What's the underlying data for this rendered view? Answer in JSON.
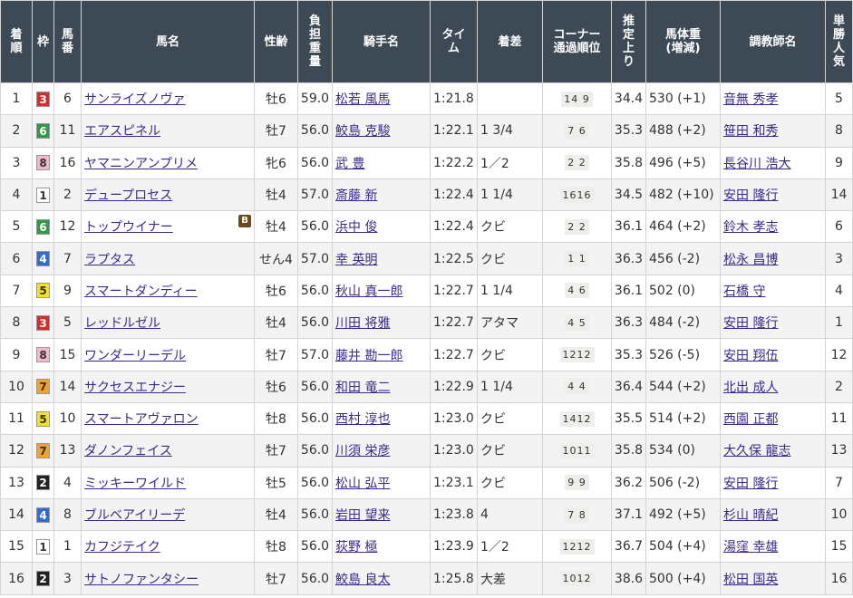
{
  "headers": [
    "着\n順",
    "枠",
    "馬\n番",
    "馬名",
    "性齢",
    "負\n担\n重\n量",
    "騎手名",
    "タイ\nム",
    "着差",
    "コーナー\n通過順位",
    "推\n定\n上\nり",
    "馬体重\n(増減)",
    "調教師名",
    "単\n勝\n人\n気"
  ],
  "waku_colors": {
    "1": {
      "bg": "#ffffff",
      "fg": "#333333"
    },
    "2": {
      "bg": "#222222",
      "fg": "#ffffff"
    },
    "3": {
      "bg": "#d92b2b",
      "fg": "#ffffff"
    },
    "4": {
      "bg": "#2f6cd6",
      "fg": "#ffffff"
    },
    "5": {
      "bg": "#f5e21d",
      "fg": "#333333"
    },
    "6": {
      "bg": "#2e9a44",
      "fg": "#ffffff"
    },
    "7": {
      "bg": "#f2a22c",
      "fg": "#333333"
    },
    "8": {
      "bg": "#f6b7cb",
      "fg": "#333333"
    }
  },
  "blinker_badge": "B",
  "rows": [
    {
      "rank": "1",
      "waku": "3",
      "num": "6",
      "name": "サンライズノヴァ",
      "blinkers": false,
      "sexage": "牡6",
      "weight": "59.0",
      "jockey": "松若 風馬",
      "time": "1:21.8",
      "margin": "",
      "pass": "14 9",
      "last3f": "34.4",
      "body": "530 (+1)",
      "trainer": "音無 秀孝",
      "pop": "5"
    },
    {
      "rank": "2",
      "waku": "6",
      "num": "11",
      "name": "エアスピネル",
      "blinkers": false,
      "sexage": "牡7",
      "weight": "56.0",
      "jockey": "鮫島 克駿",
      "time": "1:22.1",
      "margin": "1 3/4",
      "pass": "7 6",
      "last3f": "35.3",
      "body": "488 (+2)",
      "trainer": "笹田 和秀",
      "pop": "8"
    },
    {
      "rank": "3",
      "waku": "8",
      "num": "16",
      "name": "ヤマニンアンプリメ",
      "blinkers": false,
      "sexage": "牝6",
      "weight": "56.0",
      "jockey": "武 豊",
      "time": "1:22.2",
      "margin": "1／2",
      "pass": "2 2",
      "last3f": "35.8",
      "body": "496 (+5)",
      "trainer": "長谷川 浩大",
      "pop": "9"
    },
    {
      "rank": "4",
      "waku": "1",
      "num": "2",
      "name": "デュープロセス",
      "blinkers": false,
      "sexage": "牡4",
      "weight": "57.0",
      "jockey": "斎藤 新",
      "time": "1:22.4",
      "margin": "1 1/4",
      "pass": "1616",
      "last3f": "34.5",
      "body": "482 (+10)",
      "trainer": "安田 隆行",
      "pop": "14"
    },
    {
      "rank": "5",
      "waku": "6",
      "num": "12",
      "name": "トップウイナー",
      "blinkers": true,
      "sexage": "牡4",
      "weight": "56.0",
      "jockey": "浜中 俊",
      "time": "1:22.4",
      "margin": "クビ",
      "pass": "2 2",
      "last3f": "36.1",
      "body": "464 (+2)",
      "trainer": "鈴木 孝志",
      "pop": "6"
    },
    {
      "rank": "6",
      "waku": "4",
      "num": "7",
      "name": "ラプタス",
      "blinkers": false,
      "sexage": "せん4",
      "weight": "57.0",
      "jockey": "幸 英明",
      "time": "1:22.5",
      "margin": "クビ",
      "pass": "1 1",
      "last3f": "36.3",
      "body": "456 (-2)",
      "trainer": "松永 昌博",
      "pop": "3"
    },
    {
      "rank": "7",
      "waku": "5",
      "num": "9",
      "name": "スマートダンディー",
      "blinkers": false,
      "sexage": "牡6",
      "weight": "56.0",
      "jockey": "秋山 真一郎",
      "time": "1:22.7",
      "margin": "1 1/4",
      "pass": "4 6",
      "last3f": "36.1",
      "body": "502 (0)",
      "trainer": "石橋 守",
      "pop": "4"
    },
    {
      "rank": "8",
      "waku": "3",
      "num": "5",
      "name": "レッドルゼル",
      "blinkers": false,
      "sexage": "牡4",
      "weight": "56.0",
      "jockey": "川田 将雅",
      "time": "1:22.7",
      "margin": "アタマ",
      "pass": "4 5",
      "last3f": "36.3",
      "body": "484 (-2)",
      "trainer": "安田 隆行",
      "pop": "1"
    },
    {
      "rank": "9",
      "waku": "8",
      "num": "15",
      "name": "ワンダーリーデル",
      "blinkers": false,
      "sexage": "牡7",
      "weight": "57.0",
      "jockey": "藤井 勘一郎",
      "time": "1:22.7",
      "margin": "クビ",
      "pass": "1212",
      "last3f": "35.3",
      "body": "526 (-5)",
      "trainer": "安田 翔伍",
      "pop": "12"
    },
    {
      "rank": "10",
      "waku": "7",
      "num": "14",
      "name": "サクセスエナジー",
      "blinkers": false,
      "sexage": "牡6",
      "weight": "56.0",
      "jockey": "和田 竜二",
      "time": "1:22.9",
      "margin": "1 1/4",
      "pass": "4 4",
      "last3f": "36.4",
      "body": "544 (+2)",
      "trainer": "北出 成人",
      "pop": "2"
    },
    {
      "rank": "11",
      "waku": "5",
      "num": "10",
      "name": "スマートアヴァロン",
      "blinkers": false,
      "sexage": "牡8",
      "weight": "56.0",
      "jockey": "西村 淳也",
      "time": "1:23.0",
      "margin": "クビ",
      "pass": "1412",
      "last3f": "35.5",
      "body": "514 (+2)",
      "trainer": "西園 正都",
      "pop": "11"
    },
    {
      "rank": "12",
      "waku": "7",
      "num": "13",
      "name": "ダノンフェイス",
      "blinkers": false,
      "sexage": "牡7",
      "weight": "56.0",
      "jockey": "川須 栄彦",
      "time": "1:23.0",
      "margin": "クビ",
      "pass": "1011",
      "last3f": "35.8",
      "body": "534 (0)",
      "trainer": "大久保 龍志",
      "pop": "13"
    },
    {
      "rank": "13",
      "waku": "2",
      "num": "4",
      "name": "ミッキーワイルド",
      "blinkers": false,
      "sexage": "牡5",
      "weight": "56.0",
      "jockey": "松山 弘平",
      "time": "1:23.1",
      "margin": "クビ",
      "pass": "9 9",
      "last3f": "36.2",
      "body": "506 (-2)",
      "trainer": "安田 隆行",
      "pop": "7"
    },
    {
      "rank": "14",
      "waku": "4",
      "num": "8",
      "name": "ブルベアイリーデ",
      "blinkers": false,
      "sexage": "牡4",
      "weight": "56.0",
      "jockey": "岩田 望来",
      "time": "1:23.8",
      "margin": "4",
      "pass": "7 8",
      "last3f": "37.1",
      "body": "492 (+5)",
      "trainer": "杉山 晴紀",
      "pop": "10"
    },
    {
      "rank": "15",
      "waku": "1",
      "num": "1",
      "name": "カフジテイク",
      "blinkers": false,
      "sexage": "牡8",
      "weight": "56.0",
      "jockey": "荻野 極",
      "time": "1:23.9",
      "margin": "1／2",
      "pass": "1212",
      "last3f": "36.7",
      "body": "504 (+4)",
      "trainer": "湯窪 幸雄",
      "pop": "15"
    },
    {
      "rank": "16",
      "waku": "2",
      "num": "3",
      "name": "サトノファンタシー",
      "blinkers": false,
      "sexage": "牡7",
      "weight": "56.0",
      "jockey": "鮫島 良太",
      "time": "1:25.8",
      "margin": "大差",
      "pass": "1012",
      "last3f": "38.6",
      "body": "500 (+4)",
      "trainer": "松田 国英",
      "pop": "16"
    }
  ]
}
